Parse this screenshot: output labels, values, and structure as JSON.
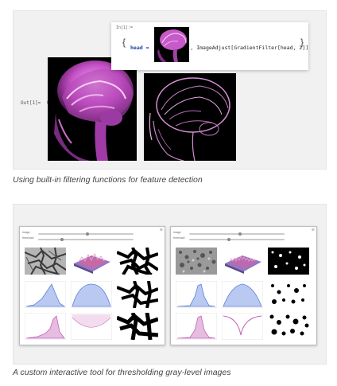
{
  "panel1": {
    "input_label": "In[1]:=",
    "code_prefix": "head = ",
    "code_suffix": ", ImageAdjust[GradientFilter[head, 2]]",
    "output_label": "Out[1]=",
    "caption": "Using built-in filtering functions for feature detection"
  },
  "panel2": {
    "caption": "A custom interactive tool for thresholding gray-level images",
    "tools": [
      {
        "slider1_label": "image",
        "slider2_label": "threshold"
      },
      {
        "slider1_label": "image",
        "slider2_label": "threshold"
      }
    ]
  },
  "colors": {
    "accent_magenta": "#d06ad6",
    "code_blue": "#1a3fb0",
    "chart_blue": "#8fa9e8",
    "chart_magenta": "#c55fb8"
  }
}
